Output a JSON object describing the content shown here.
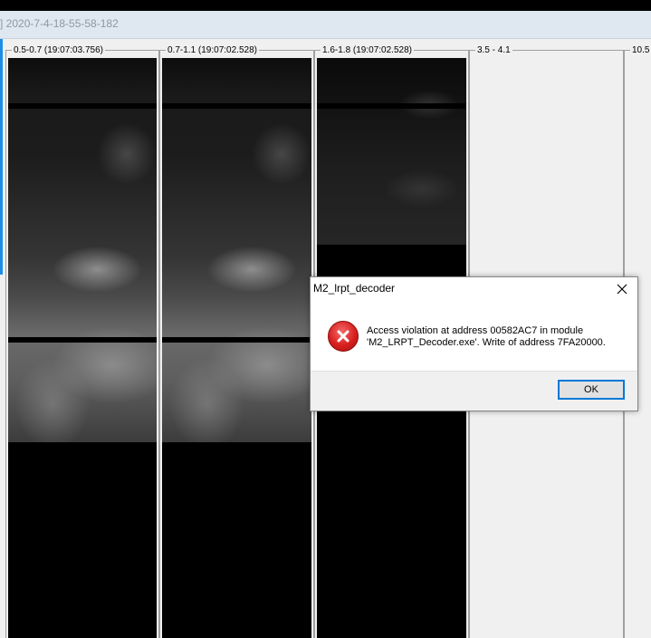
{
  "window": {
    "title_fragment": "] 2020-7-4-18-55-58-182"
  },
  "channels": [
    {
      "label": "0.5-0.7 (19:07:03.756)"
    },
    {
      "label": "0.7-1.1 (19:07:02.528)"
    },
    {
      "label": "1.6-1.8 (19:07:02.528)"
    },
    {
      "label": "3.5 - 4.1"
    },
    {
      "label": "10.5"
    }
  ],
  "dialog": {
    "title": "M2_lrpt_decoder",
    "message_line1": "Access violation at address 00582AC7 in module",
    "message_line2": "'M2_LRPT_Decoder.exe'. Write of address 7FA20000.",
    "ok_label": "OK",
    "icon": "error-icon"
  },
  "colors": {
    "title_bar": "#dfe8f0",
    "error_red": "#d81f1f",
    "button_focus": "#0078d7"
  }
}
